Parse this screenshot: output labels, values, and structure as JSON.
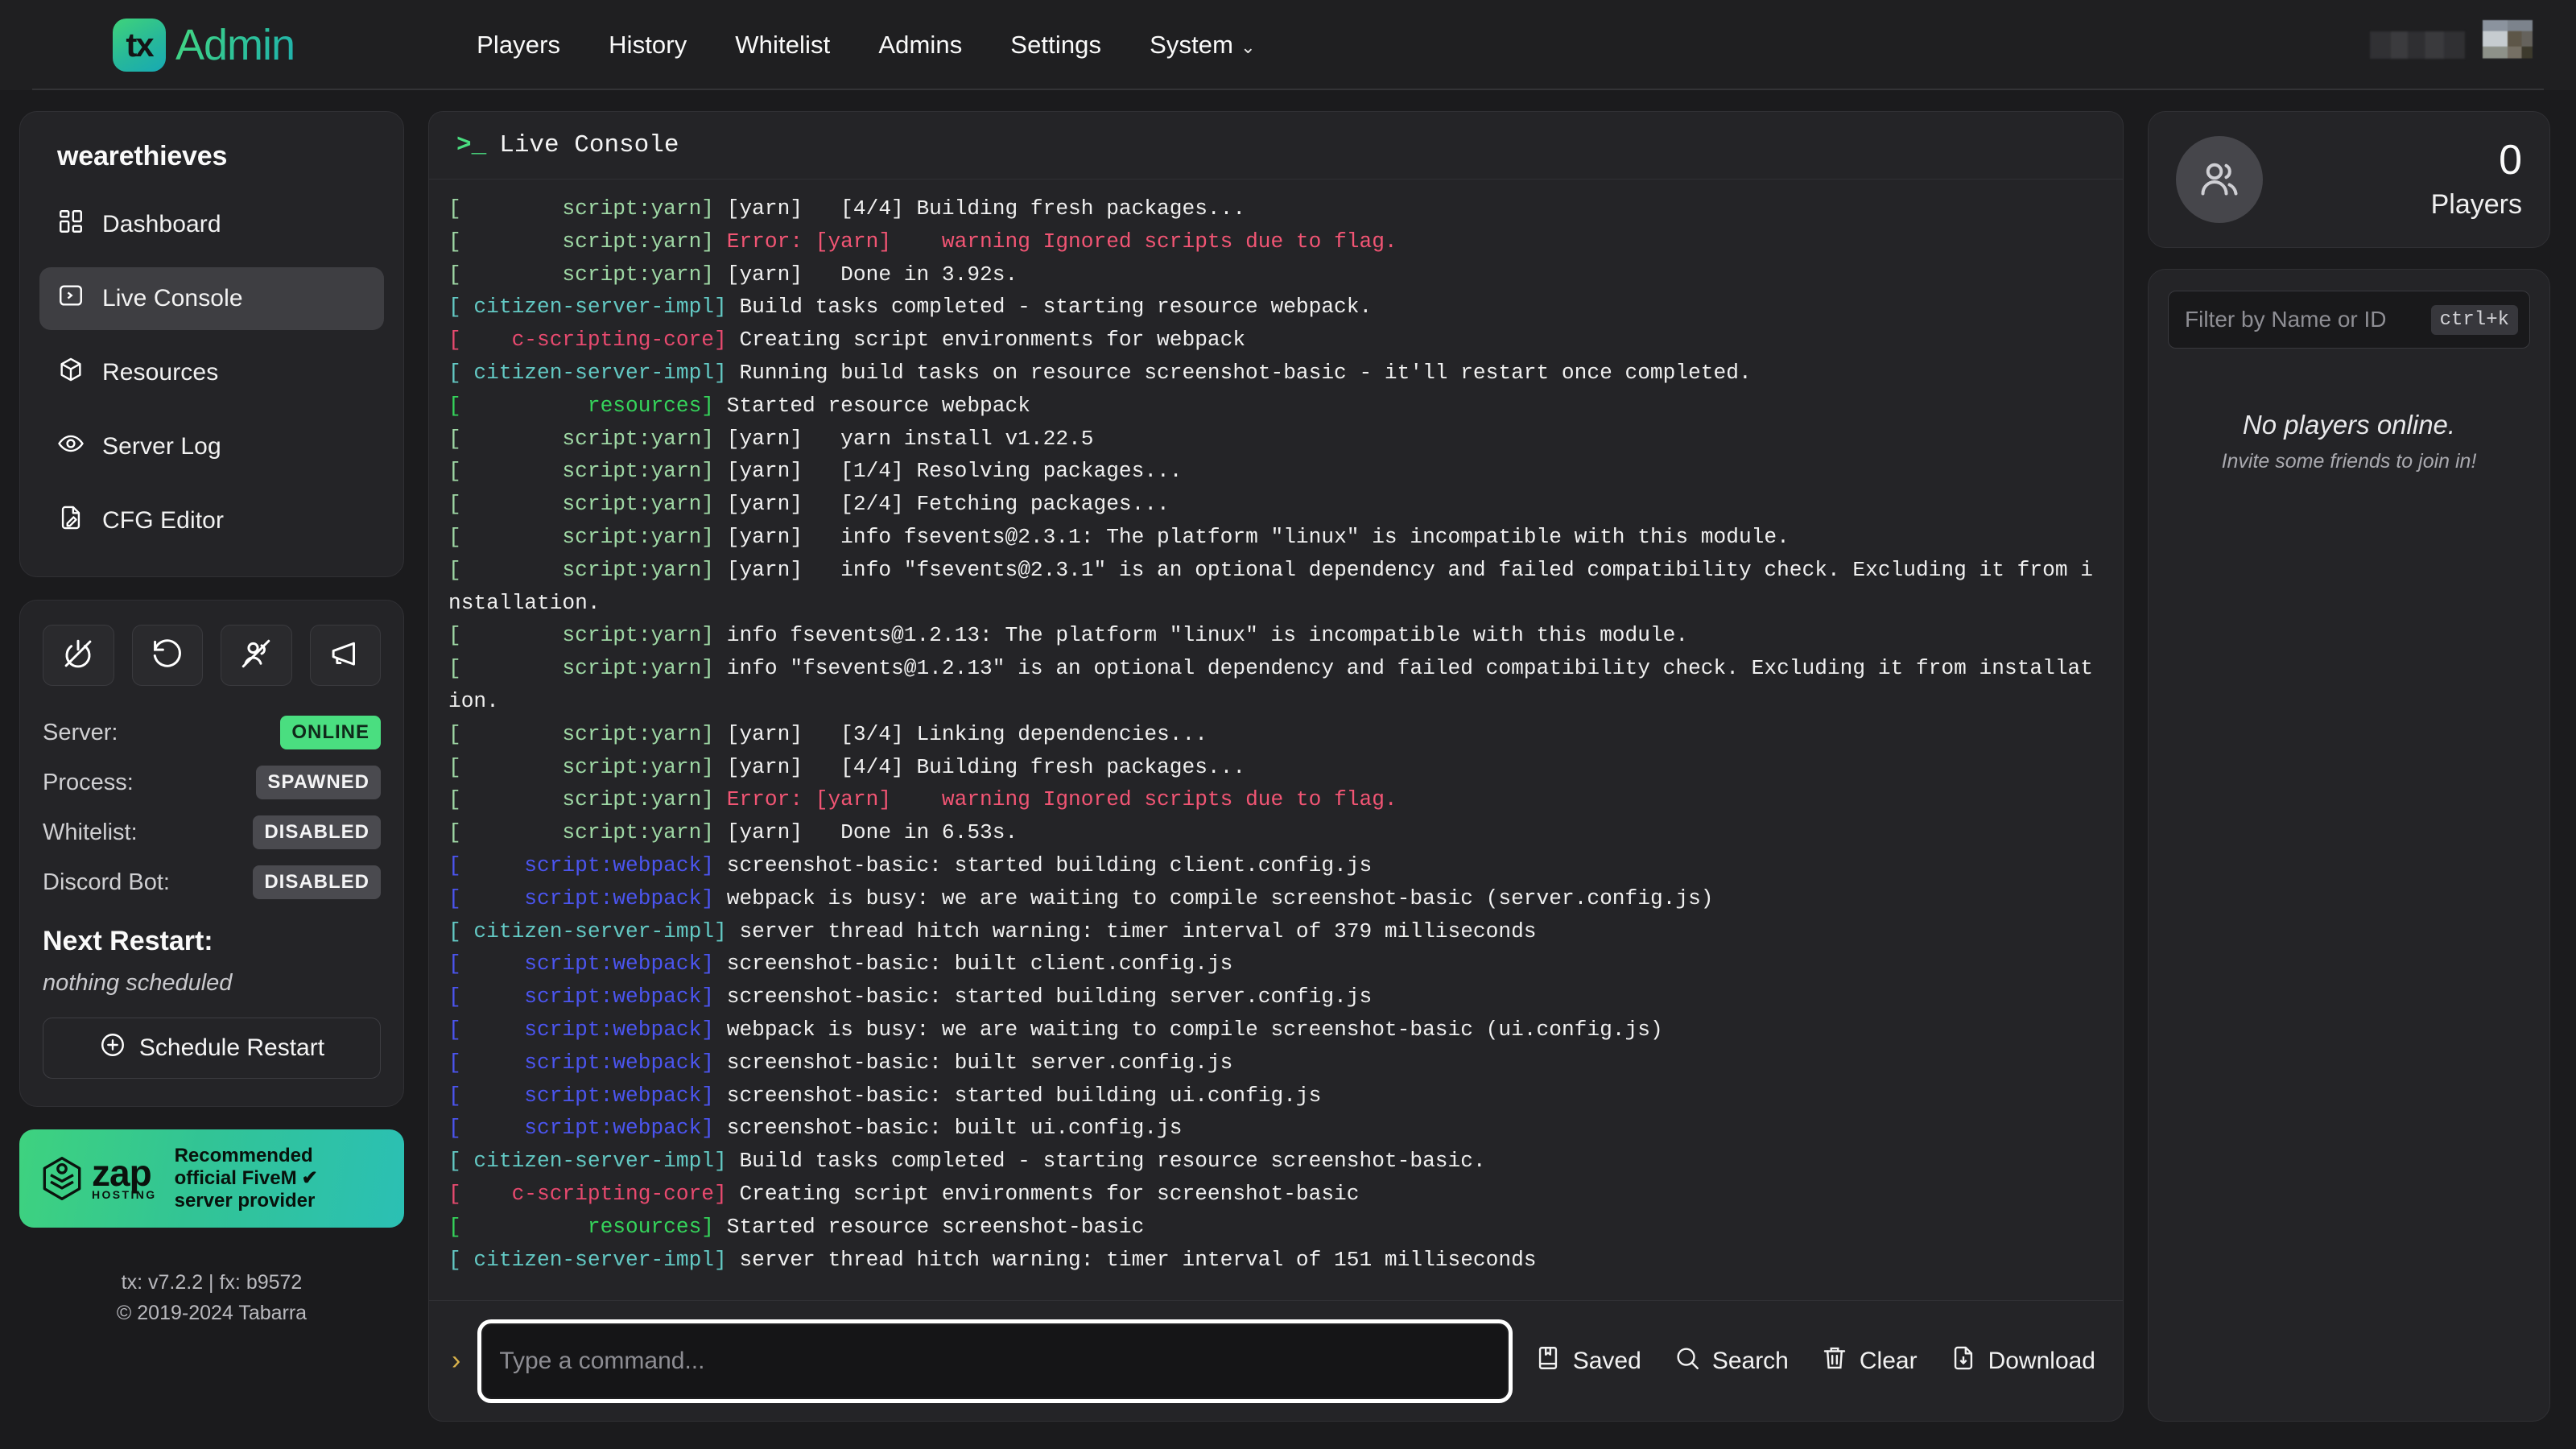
{
  "navbar": {
    "brand_mark": "tx",
    "brand_text": "Admin",
    "links": [
      {
        "label": "Players",
        "has_chevron": false
      },
      {
        "label": "History",
        "has_chevron": false
      },
      {
        "label": "Whitelist",
        "has_chevron": false
      },
      {
        "label": "Admins",
        "has_chevron": false
      },
      {
        "label": "Settings",
        "has_chevron": false
      },
      {
        "label": "System",
        "has_chevron": true
      }
    ],
    "chevron_glyph": "⌄"
  },
  "sidebar": {
    "server_name": "wearethieves",
    "menu": [
      {
        "label": "Dashboard",
        "icon": "grid-icon",
        "active": false
      },
      {
        "label": "Live Console",
        "icon": "terminal-icon",
        "active": true
      },
      {
        "label": "Resources",
        "icon": "box-icon",
        "active": false
      },
      {
        "label": "Server Log",
        "icon": "eye-icon",
        "active": false
      },
      {
        "label": "CFG Editor",
        "icon": "file-edit-icon",
        "active": false
      }
    ],
    "controls": [
      {
        "name": "stop-server-button",
        "icon": "power-off-icon"
      },
      {
        "name": "restart-server-button",
        "icon": "rotate-ccw-icon"
      },
      {
        "name": "kick-all-button",
        "icon": "users-slash-icon"
      },
      {
        "name": "announcement-button",
        "icon": "megaphone-icon"
      }
    ],
    "status": [
      {
        "label": "Server:",
        "value": "ONLINE",
        "tone": "online"
      },
      {
        "label": "Process:",
        "value": "SPAWNED",
        "tone": "neutral"
      },
      {
        "label": "Whitelist:",
        "value": "DISABLED",
        "tone": "neutral"
      },
      {
        "label": "Discord Bot:",
        "value": "DISABLED",
        "tone": "neutral"
      }
    ],
    "next_restart_title": "Next Restart:",
    "next_restart_value": "nothing scheduled",
    "schedule_button": "Schedule Restart",
    "zap": {
      "word": "zap",
      "word_sub": "HOSTING",
      "line1": "Recommended",
      "line2": "official FiveM",
      "line3": "server provider",
      "verified_glyph": "✔"
    },
    "footer_version": "tx: v7.2.2 | fx: b9572",
    "footer_copyright": "© 2019-2024 Tabarra"
  },
  "console": {
    "title": "Live Console",
    "prompt_glyph": ">_",
    "caret": "›",
    "input_placeholder": "Type a command...",
    "input_value": "",
    "actions": [
      {
        "label": "Saved",
        "icon": "bookmark-icon"
      },
      {
        "label": "Search",
        "icon": "search-icon"
      },
      {
        "label": "Clear",
        "icon": "trash-icon"
      },
      {
        "label": "Download",
        "icon": "download-icon"
      }
    ],
    "lines": [
      {
        "prefix": "[        script:yarn]",
        "prefix_class": "c-yarn",
        "segments": [
          {
            "t": " [yarn]   [4/4] Building fresh packages...",
            "c": ""
          }
        ]
      },
      {
        "prefix": "[        script:yarn]",
        "prefix_class": "c-yarn",
        "segments": [
          {
            "t": " Error: [yarn]    warning Ignored scripts due to flag.",
            "c": "c-err"
          }
        ]
      },
      {
        "prefix": "[        script:yarn]",
        "prefix_class": "c-yarn",
        "segments": [
          {
            "t": " [yarn]   Done in 3.92s.",
            "c": ""
          }
        ]
      },
      {
        "prefix": "[ citizen-server-impl]",
        "prefix_class": "c-citizen",
        "segments": [
          {
            "t": " Build tasks completed - starting resource webpack.",
            "c": ""
          }
        ]
      },
      {
        "prefix": "[    c-scripting-core]",
        "prefix_class": "c-core",
        "segments": [
          {
            "t": " Creating script environments for webpack",
            "c": ""
          }
        ]
      },
      {
        "prefix": "[ citizen-server-impl]",
        "prefix_class": "c-citizen",
        "segments": [
          {
            "t": " Running build tasks on resource screenshot-basic - it'll restart once completed.",
            "c": ""
          }
        ]
      },
      {
        "prefix": "[          resources]",
        "prefix_class": "c-res",
        "segments": [
          {
            "t": " Started resource webpack",
            "c": ""
          }
        ]
      },
      {
        "prefix": "[        script:yarn]",
        "prefix_class": "c-yarn",
        "segments": [
          {
            "t": " [yarn]   yarn install v1.22.5",
            "c": ""
          }
        ]
      },
      {
        "prefix": "[        script:yarn]",
        "prefix_class": "c-yarn",
        "segments": [
          {
            "t": " [yarn]   [1/4] Resolving packages...",
            "c": ""
          }
        ]
      },
      {
        "prefix": "[        script:yarn]",
        "prefix_class": "c-yarn",
        "segments": [
          {
            "t": " [yarn]   [2/4] Fetching packages...",
            "c": ""
          }
        ]
      },
      {
        "prefix": "[        script:yarn]",
        "prefix_class": "c-yarn",
        "segments": [
          {
            "t": " [yarn]   info fsevents@2.3.1: The platform \"linux\" is incompatible with this module.",
            "c": ""
          }
        ]
      },
      {
        "prefix": "[        script:yarn]",
        "prefix_class": "c-yarn",
        "segments": [
          {
            "t": " [yarn]   info \"fsevents@2.3.1\" is an optional dependency and failed compatibility check. Excluding it from installation.",
            "c": ""
          }
        ]
      },
      {
        "prefix": "[        script:yarn]",
        "prefix_class": "c-yarn",
        "segments": [
          {
            "t": " info fsevents@1.2.13: The platform \"linux\" is incompatible with this module.",
            "c": ""
          }
        ]
      },
      {
        "prefix": "[        script:yarn]",
        "prefix_class": "c-yarn",
        "segments": [
          {
            "t": " info \"fsevents@1.2.13\" is an optional dependency and failed compatibility check. Excluding it from installation.",
            "c": ""
          }
        ]
      },
      {
        "prefix": "[        script:yarn]",
        "prefix_class": "c-yarn",
        "segments": [
          {
            "t": " [yarn]   [3/4] Linking dependencies...",
            "c": ""
          }
        ]
      },
      {
        "prefix": "[        script:yarn]",
        "prefix_class": "c-yarn",
        "segments": [
          {
            "t": " [yarn]   [4/4] Building fresh packages...",
            "c": ""
          }
        ]
      },
      {
        "prefix": "[        script:yarn]",
        "prefix_class": "c-yarn",
        "segments": [
          {
            "t": " Error: [yarn]    warning Ignored scripts due to flag.",
            "c": "c-err"
          }
        ]
      },
      {
        "prefix": "[        script:yarn]",
        "prefix_class": "c-yarn",
        "segments": [
          {
            "t": " [yarn]   Done in 6.53s.",
            "c": ""
          }
        ]
      },
      {
        "prefix": "[     script:webpack]",
        "prefix_class": "c-webpack",
        "segments": [
          {
            "t": " screenshot-basic: started building client.config.js",
            "c": ""
          }
        ]
      },
      {
        "prefix": "[     script:webpack]",
        "prefix_class": "c-webpack",
        "segments": [
          {
            "t": " webpack is busy: we are waiting to compile screenshot-basic (server.config.js)",
            "c": ""
          }
        ]
      },
      {
        "prefix": "[ citizen-server-impl]",
        "prefix_class": "c-citizen",
        "segments": [
          {
            "t": " server thread hitch warning: timer interval of 379 milliseconds",
            "c": ""
          }
        ]
      },
      {
        "prefix": "[     script:webpack]",
        "prefix_class": "c-webpack",
        "segments": [
          {
            "t": " screenshot-basic: built client.config.js",
            "c": ""
          }
        ]
      },
      {
        "prefix": "[     script:webpack]",
        "prefix_class": "c-webpack",
        "segments": [
          {
            "t": " screenshot-basic: started building server.config.js",
            "c": ""
          }
        ]
      },
      {
        "prefix": "[     script:webpack]",
        "prefix_class": "c-webpack",
        "segments": [
          {
            "t": " webpack is busy: we are waiting to compile screenshot-basic (ui.config.js)",
            "c": ""
          }
        ]
      },
      {
        "prefix": "[     script:webpack]",
        "prefix_class": "c-webpack",
        "segments": [
          {
            "t": " screenshot-basic: built server.config.js",
            "c": ""
          }
        ]
      },
      {
        "prefix": "[     script:webpack]",
        "prefix_class": "c-webpack",
        "segments": [
          {
            "t": " screenshot-basic: started building ui.config.js",
            "c": ""
          }
        ]
      },
      {
        "prefix": "[     script:webpack]",
        "prefix_class": "c-webpack",
        "segments": [
          {
            "t": " screenshot-basic: built ui.config.js",
            "c": ""
          }
        ]
      },
      {
        "prefix": "[ citizen-server-impl]",
        "prefix_class": "c-citizen",
        "segments": [
          {
            "t": " Build tasks completed - starting resource screenshot-basic.",
            "c": ""
          }
        ]
      },
      {
        "prefix": "[    c-scripting-core]",
        "prefix_class": "c-core",
        "segments": [
          {
            "t": " Creating script environments for screenshot-basic",
            "c": ""
          }
        ]
      },
      {
        "prefix": "[          resources]",
        "prefix_class": "c-res",
        "segments": [
          {
            "t": " Started resource screenshot-basic",
            "c": ""
          }
        ]
      },
      {
        "prefix": "[ citizen-server-impl]",
        "prefix_class": "c-citizen",
        "segments": [
          {
            "t": " server thread hitch warning: timer interval of 151 milliseconds",
            "c": ""
          }
        ]
      }
    ]
  },
  "players_panel": {
    "count": "0",
    "count_label": "Players",
    "filter_placeholder": "Filter by Name or ID",
    "filter_value": "",
    "shortcut": "ctrl+k",
    "empty_title": "No players online.",
    "empty_sub": "Invite some friends to join in!"
  },
  "colors": {
    "accent_green": "#4ade80",
    "brand_teal": "#2bc0b4",
    "panel_bg": "#242427",
    "page_bg": "#1b1b1d"
  }
}
